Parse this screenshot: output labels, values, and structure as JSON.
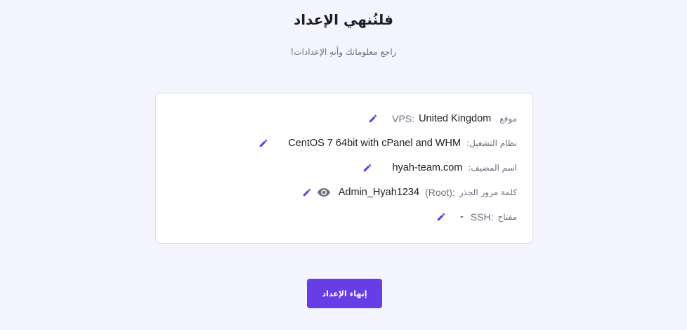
{
  "header": {
    "title": "فلنُنهي الإعداد",
    "subtitle": "راجع معلوماتك وأنهِ الإعدادات!"
  },
  "summary": {
    "location": {
      "label": "موقع",
      "label_latin": "VPS:",
      "value": "United Kingdom"
    },
    "os": {
      "label": "نظام التشغيل:",
      "value": "CentOS 7 64bit with cPanel and WHM"
    },
    "hostname": {
      "label": "اسم المضيف:",
      "value": "hyah-team.com"
    },
    "root_password": {
      "label": "كلمة مرور الجذر",
      "label_latin": "(Root):",
      "value": "Admin_Hyah1234"
    },
    "ssh_key": {
      "label": "مفتاح",
      "label_latin": "SSH:",
      "value": "-"
    }
  },
  "footer": {
    "finish_label": "إنهاء الإعداد"
  },
  "colors": {
    "accent": "#673de6",
    "background": "#f4f4fe",
    "icon_gray": "#6d7081"
  },
  "icons": {
    "edit": "pencil-icon",
    "reveal": "eye-icon"
  }
}
